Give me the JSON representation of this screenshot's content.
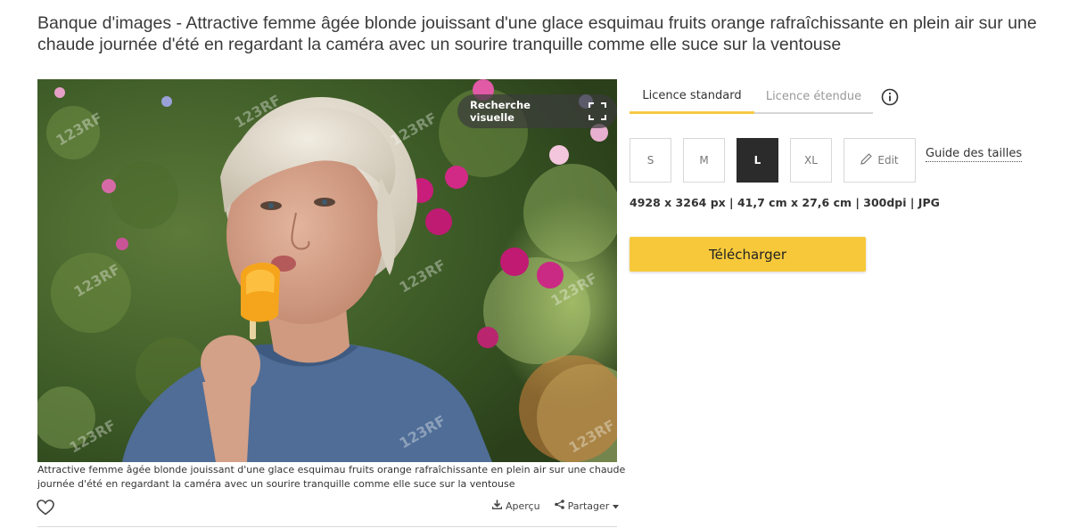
{
  "page": {
    "title": "Banque d'images - Attractive femme âgée blonde jouissant d'une glace esquimau fruits orange rafraîchissante en plein air sur une chaude journée d'été en regardant la caméra avec un sourire tranquille comme elle suce sur la ventouse"
  },
  "image": {
    "visual_search_label": "Recherche visuelle",
    "watermark_text": "123RF",
    "caption": "Attractive femme âgée blonde jouissant d'une glace esquimau fruits orange rafraîchissante en plein air sur une chaude journée d'été en regardant la caméra avec un sourire tranquille comme elle suce sur la ventouse"
  },
  "actions": {
    "preview_label": "Aperçu",
    "share_label": "Partager"
  },
  "license": {
    "tabs": [
      {
        "label": "Licence standard",
        "active": true
      },
      {
        "label": "Licence étendue",
        "active": false
      }
    ]
  },
  "sizes": {
    "options": [
      "S",
      "M",
      "L",
      "XL"
    ],
    "selected": "L",
    "edit_label": "Edit",
    "guide_label": "Guide des tailles"
  },
  "specs": "4928 x 3264 px | 41,7 cm x 27,6 cm | 300dpi | JPG",
  "download_label": "Télécharger",
  "colors": {
    "accent": "#f7c93a",
    "tab_underline": "#f6c945",
    "selected_size_bg": "#2b2b2b"
  },
  "icons": [
    "frame-icon",
    "heart-icon",
    "download-icon",
    "share-icon",
    "caret-down-icon",
    "info-icon",
    "pencil-icon"
  ]
}
